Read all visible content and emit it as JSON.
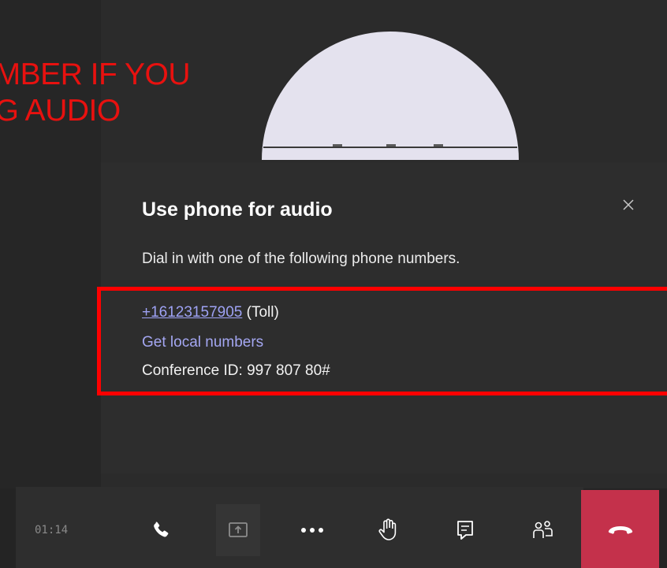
{
  "annotation": {
    "line1": "UMBER IF YOU",
    "line2": "NG AUDIO"
  },
  "dialog": {
    "title": "Use phone for audio",
    "subtitle": "Dial in with one of the following phone numbers.",
    "phone_number": "+16123157905",
    "phone_type": "(Toll)",
    "local_numbers_link": "Get local numbers",
    "conference_id": "Conference ID: 997 807 80#"
  },
  "toolbar": {
    "timer": "01:14",
    "buttons": [
      "phone-icon",
      "share-tray-icon",
      "more-options-icon",
      "raise-hand-icon",
      "chat-icon",
      "participants-icon",
      "hang-up-icon"
    ]
  },
  "colors": {
    "annotation": "#e8110f",
    "highlight_box": "#ff0000",
    "link": "#9ea2f4",
    "hangup": "#c4314b"
  }
}
